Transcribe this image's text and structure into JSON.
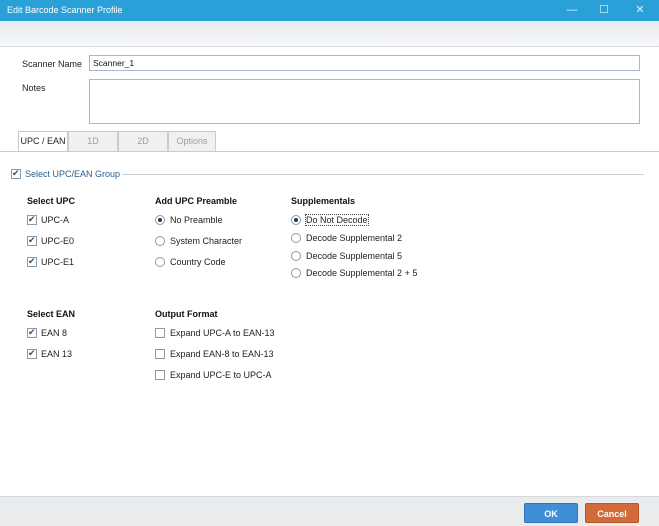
{
  "window": {
    "title": "Edit Barcode Scanner Profile",
    "min_glyph": "—",
    "max_glyph": "☐",
    "close_glyph": "✕"
  },
  "form": {
    "scanner_name_label": "Scanner Name",
    "scanner_name_value": "Scanner_1",
    "notes_label": "Notes",
    "notes_value": ""
  },
  "tabs": [
    {
      "label": "UPC / EAN",
      "active": true
    },
    {
      "label": "1D",
      "active": false
    },
    {
      "label": "2D",
      "active": false
    },
    {
      "label": "Options",
      "active": false
    }
  ],
  "group": {
    "label": "Select UPC/EAN Group",
    "checked": true
  },
  "select_upc": {
    "heading": "Select UPC",
    "items": [
      {
        "label": "UPC-A",
        "checked": true
      },
      {
        "label": "UPC-E0",
        "checked": true
      },
      {
        "label": "UPC-E1",
        "checked": true
      }
    ]
  },
  "add_upc_preamble": {
    "heading": "Add UPC Preamble",
    "options": [
      {
        "label": "No Preamble",
        "selected": true
      },
      {
        "label": "System Character",
        "selected": false
      },
      {
        "label": "Country Code",
        "selected": false
      }
    ]
  },
  "supplementals": {
    "heading": "Supplementals",
    "options": [
      {
        "label": "Do Not Decode",
        "selected": true
      },
      {
        "label": "Decode Supplemental 2",
        "selected": false
      },
      {
        "label": "Decode Supplemental 5",
        "selected": false
      },
      {
        "label": "Decode Supplemental 2 + 5",
        "selected": false
      }
    ]
  },
  "select_ean": {
    "heading": "Select EAN",
    "items": [
      {
        "label": "EAN 8",
        "checked": true
      },
      {
        "label": "EAN 13",
        "checked": true
      }
    ]
  },
  "output_format": {
    "heading": "Output Format",
    "items": [
      {
        "label": "Expand UPC-A to EAN-13",
        "checked": false
      },
      {
        "label": "Expand EAN-8 to EAN-13",
        "checked": false
      },
      {
        "label": "Expand UPC-E to UPC-A",
        "checked": false
      }
    ]
  },
  "footer": {
    "ok_label": "OK",
    "cancel_label": "Cancel"
  },
  "colors": {
    "titlebar": "#2aa0d8",
    "ok": "#3f8fd8",
    "cancel": "#d26a3a"
  }
}
